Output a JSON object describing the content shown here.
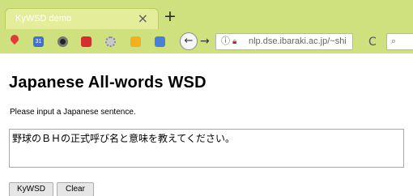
{
  "browser": {
    "tab_title": "KyWSD demo",
    "close_symbol": "×",
    "new_tab_symbol": "+",
    "extensions": [
      "map-pin-icon",
      "calendar-icon",
      "chrome-icon",
      "youtube-icon",
      "gear-icon",
      "checklist-icon",
      "translate-icon"
    ],
    "calendar_badge": "31",
    "back_symbol": "←",
    "forward_symbol": "→",
    "url": "nlp.dse.ibaraki.ac.jp/~shi",
    "reload_symbol": "C",
    "colors": {
      "chrome_bg": "#cfe07f",
      "tab_bg": "#e3ed9a"
    }
  },
  "page": {
    "title": "Japanese All-words WSD",
    "prompt": "Please input a Japanese sentence.",
    "input_value": "野球のＢＨの正式呼び名と意味を教えてください。",
    "buttons": {
      "submit": "KyWSD",
      "clear": "Clear"
    }
  }
}
